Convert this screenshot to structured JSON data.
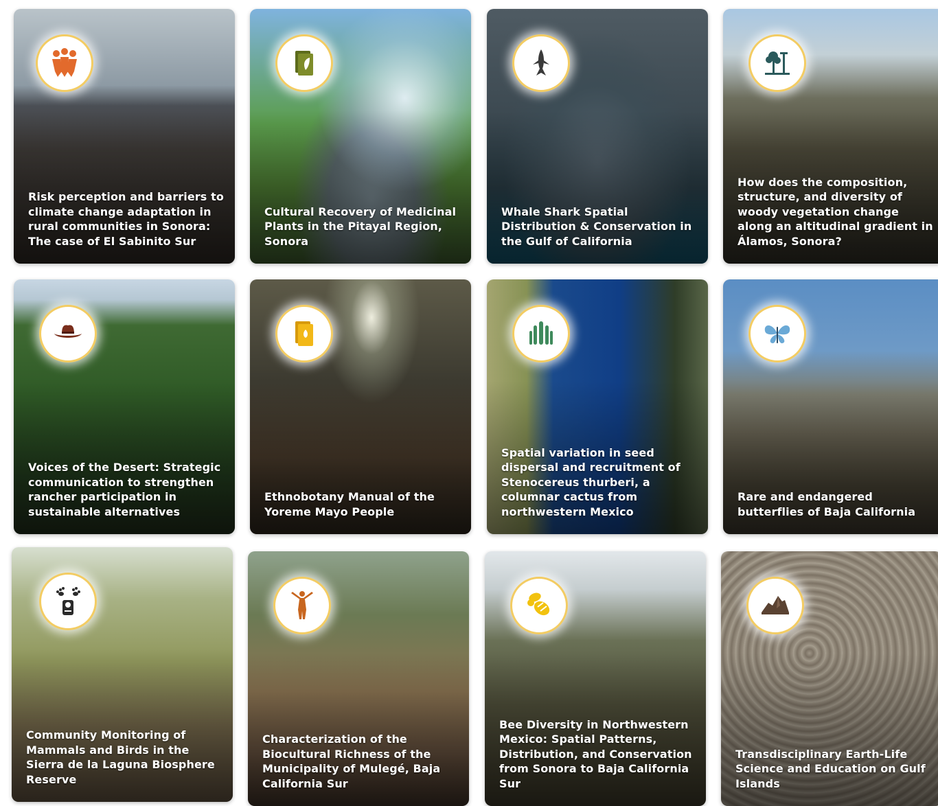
{
  "colors": {
    "badge_ring": "#f3cc63",
    "card_title": "#ffffff"
  },
  "cards": [
    {
      "title": "Risk perception and barriers to climate change adaptation in rural communities in Sonora: The case of El Sabinito Sur",
      "icon": "community-people-icon",
      "icon_color": "#e26a2c"
    },
    {
      "title": "Cultural Recovery of Medicinal Plants in the Pitayal Region, Sonora",
      "icon": "plant-book-icon",
      "icon_color": "#7e8c2a"
    },
    {
      "title": "Whale Shark Spatial Distribution & Conservation in the Gulf of California",
      "icon": "whale-shark-icon",
      "icon_color": "#3a3a3a"
    },
    {
      "title": "How does the composition, structure, and diversity of woody vegetation change along an altitudinal gradient in Álamos, Sonora?",
      "icon": "tree-gradient-icon",
      "icon_color": "#2b5a5c"
    },
    {
      "title": "Voices of the Desert: Strategic communication to strengthen rancher participation in sustainable alternatives",
      "icon": "cowboy-hat-icon",
      "icon_color": "#7a2e1c"
    },
    {
      "title": "Ethnobotany Manual of the Yoreme Mayo People",
      "icon": "manual-book-icon",
      "icon_color": "#f2b818"
    },
    {
      "title": "Spatial variation in seed dispersal and recruitment of Stenocereus thurberi, a columnar cactus from northwestern Mexico",
      "icon": "cactus-icon",
      "icon_color": "#3f8a5c"
    },
    {
      "title": "Rare and endangered butterflies of Baja California",
      "icon": "butterfly-icon",
      "icon_color": "#6aa9d6"
    },
    {
      "title": "Community Monitoring of Mammals and Birds in the Sierra de la Laguna Biosphere Reserve",
      "icon": "paw-camera-trap-icon",
      "icon_color": "#2b2b2b"
    },
    {
      "title": "Characterization of the Biocultural Richness of the Municipality of Mulegé, Baja California Sur",
      "icon": "dancer-icon",
      "icon_color": "#c8661f"
    },
    {
      "title": "Bee Diversity in Northwestern Mexico: Spatial Patterns, Distribution, and Conservation from Sonora to Baja California Sur",
      "icon": "bee-icon",
      "icon_color": "#f2c20f"
    },
    {
      "title": "Transdisciplinary Earth-Life Science and Education on Gulf Islands",
      "icon": "island-rock-icon",
      "icon_color": "#5a4232"
    }
  ]
}
